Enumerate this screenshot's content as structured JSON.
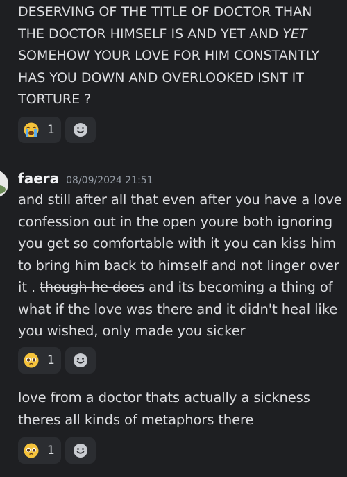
{
  "message1": {
    "lines": [
      "DESERVING OF THE TITLE OF DOCTOR THAN",
      "THE DOCTOR HIMSELF IS AND YET AND ",
      "YET",
      "SOMEHOW YOUR LOVE FOR HIM CONSTANTLY",
      "HAS YOU DOWN AND OVERLOOKED ISNT IT",
      "TORTURE ?"
    ],
    "reaction": {
      "emoji": "crying-face",
      "count": "1"
    }
  },
  "message2": {
    "username": "faera",
    "timestamp": "08/09/2024 21:51",
    "lines": [
      "and still after all that even after you have a love",
      "confession out in the open youre both ignoring",
      "you get so comfortable with it you can kiss him",
      "to bring him back to himself and not linger over",
      "it . ",
      "though he does",
      " and its becoming a thing of",
      "what if the love was there and it didn't heal like",
      "you wished, only made you sicker"
    ],
    "reaction": {
      "emoji": "pleading-face",
      "count": "1"
    }
  },
  "message3": {
    "lines": [
      "love from a doctor thats actually a sickness",
      "theres all kinds of metaphors there"
    ],
    "reaction": {
      "emoji": "pleading-face",
      "count": "1"
    }
  },
  "colors": {
    "background": "#1e1f22",
    "reaction_bg": "#2b2d31",
    "text": "#dcdde0",
    "timestamp": "#949ba4"
  }
}
